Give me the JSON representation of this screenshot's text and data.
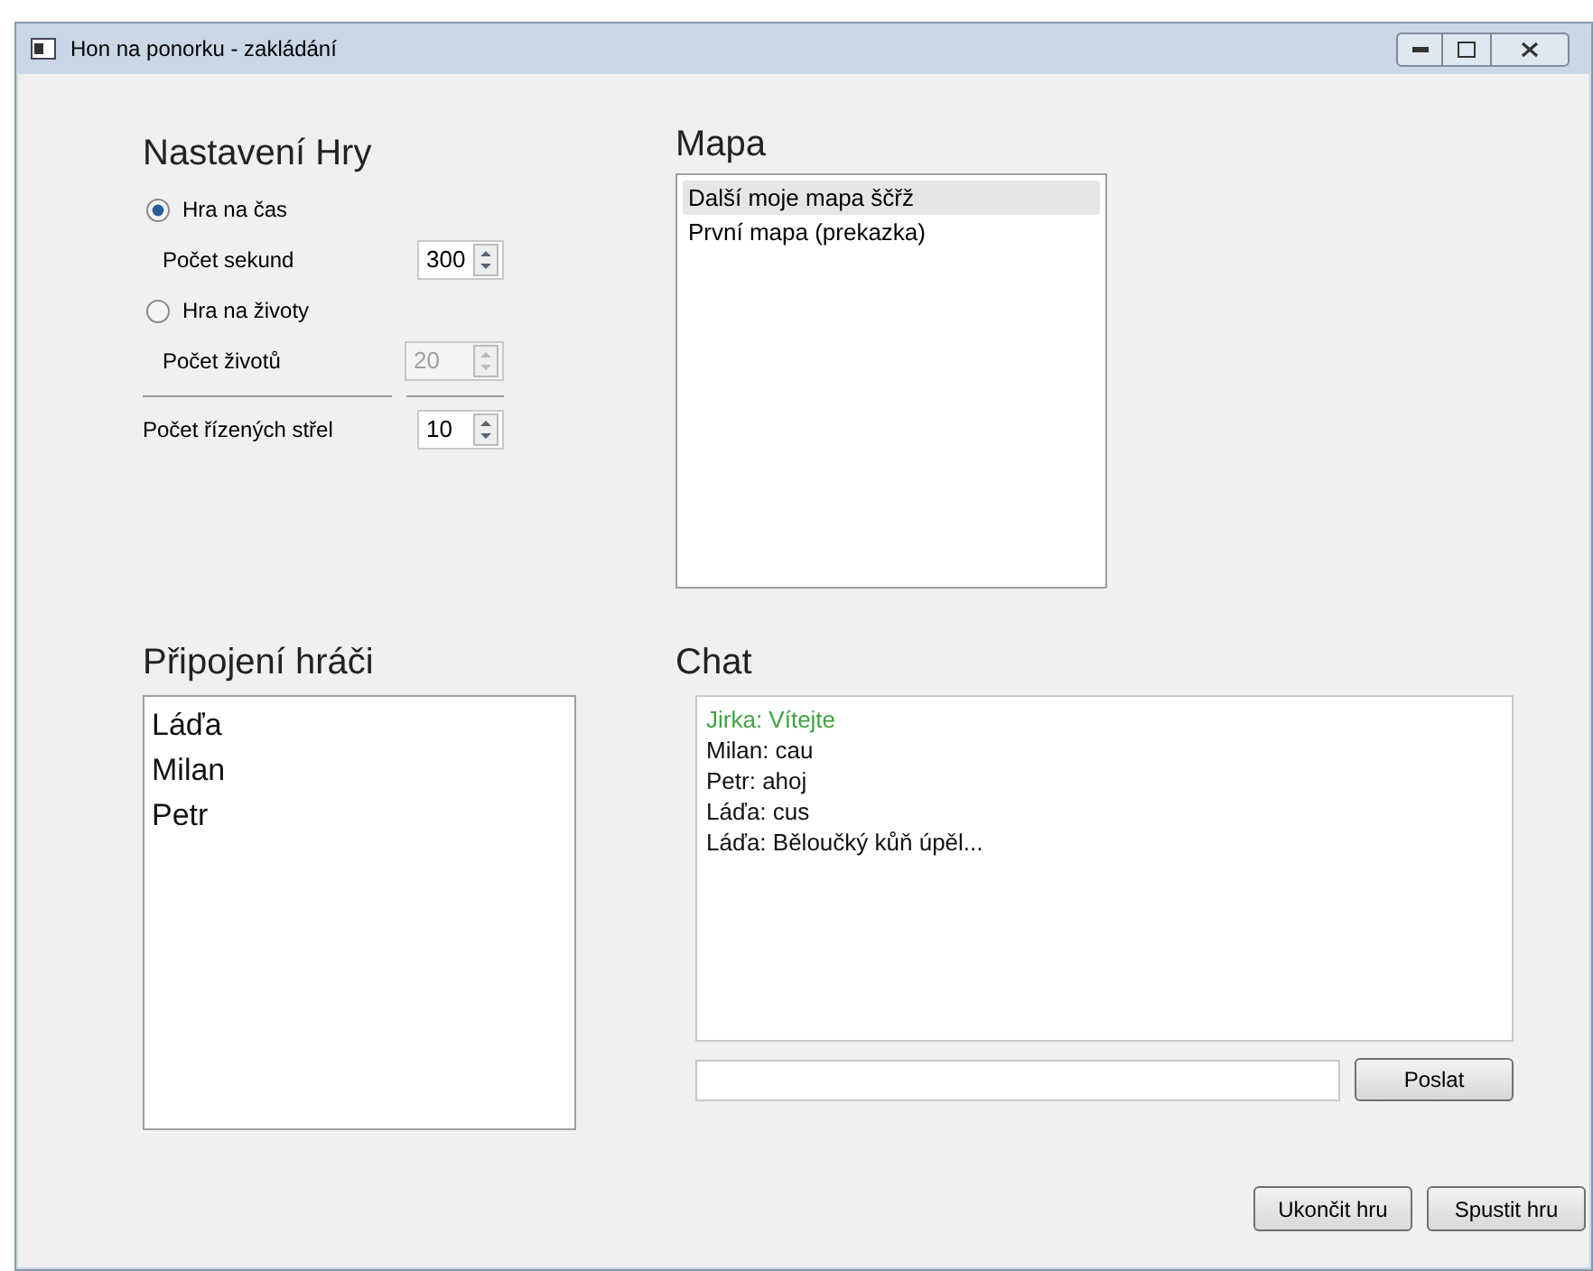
{
  "window": {
    "title": "Hon na ponorku - zakládání"
  },
  "settings": {
    "title": "Nastavení Hry",
    "modes": [
      {
        "label": "Hra na čas",
        "selected": true,
        "field": {
          "label": "Počet sekund",
          "value": "300",
          "disabled": false
        }
      },
      {
        "label": "Hra na životy",
        "selected": false,
        "field": {
          "label": "Počet životů",
          "value": "20",
          "disabled": true
        }
      }
    ],
    "missiles": {
      "label": "Počet řízených střel",
      "value": "10",
      "disabled": false
    }
  },
  "map": {
    "title": "Mapa",
    "items": [
      {
        "label": "Další moje mapa ščřž",
        "selected": true
      },
      {
        "label": "První mapa (prekazka)",
        "selected": false
      }
    ]
  },
  "players": {
    "title": "Připojení hráči",
    "items": [
      "Láďa",
      "Milan",
      "Petr"
    ]
  },
  "chat": {
    "title": "Chat",
    "messages": [
      {
        "text": "Jirka: Vítejte",
        "kind": "system"
      },
      {
        "text": "Milan: cau",
        "kind": "user"
      },
      {
        "text": "Petr: ahoj",
        "kind": "user"
      },
      {
        "text": "Láďa: cus",
        "kind": "user"
      },
      {
        "text": "Láďa: Běloučký kůň úpěl...",
        "kind": "user"
      }
    ],
    "send": "Poslat"
  },
  "buttons": [
    "Ukončit hru",
    "Spustit hru"
  ]
}
